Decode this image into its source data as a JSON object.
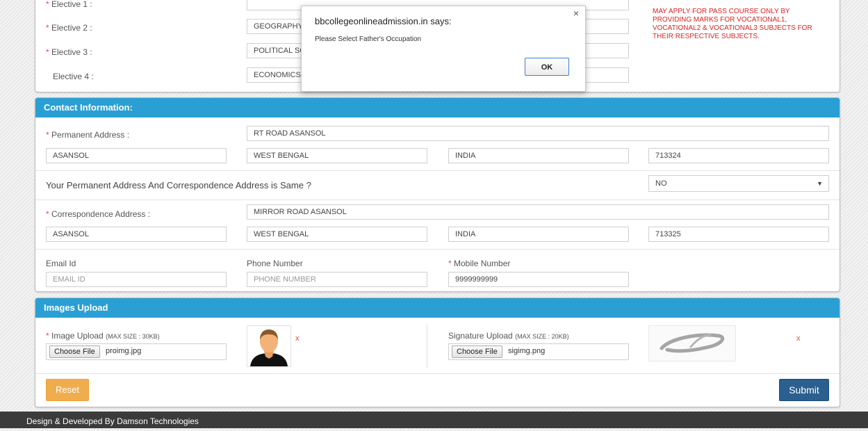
{
  "electives": {
    "rows": [
      {
        "label": "Elective 1 :",
        "value": "",
        "required": true
      },
      {
        "label": "Elective 2 :",
        "value": "GEOGRAPHY",
        "required": true
      },
      {
        "label": "Elective 3 :",
        "value": "POLITICAL SC",
        "required": true
      },
      {
        "label": "Elective 4 :",
        "value": "ECONOMICS",
        "required": false
      }
    ],
    "notice": "MAY APPLY FOR PASS COURSE ONLY BY PROVIDING MARKS FOR VOCATIONAL1, VOCATIONAL2 & VOCATIONAL3 SUBJECTS FOR THEIR RESPECTIVE SUBJECTS."
  },
  "dialog": {
    "title": "bbcollegeonlineadmission.in says:",
    "message": "Please Select Father's Occupation",
    "ok_label": "OK",
    "close_glyph": "×"
  },
  "contact": {
    "header": "Contact Information:",
    "permanent_label": "Permanent Address :",
    "permanent_address": "RT ROAD ASANSOL",
    "permanent_city": "ASANSOL",
    "permanent_state": "WEST BENGAL",
    "permanent_country": "INDIA",
    "permanent_pin": "713324",
    "same_question": "Your Permanent Address And Correspondence Address is Same ?",
    "same_value": "NO",
    "correspondence_label": "Correspondence Address :",
    "correspondence_address": "MIRROR ROAD ASANSOL",
    "correspondence_city": "ASANSOL",
    "correspondence_state": "WEST BENGAL",
    "correspondence_country": "INDIA",
    "correspondence_pin": "713325",
    "email_label": "Email Id",
    "email_placeholder": "EMAIL ID",
    "phone_label": "Phone Number",
    "phone_placeholder": "PHONE NUMBER",
    "mobile_label": "Mobile Number",
    "mobile_value": "9999999999"
  },
  "images": {
    "header": "Images Upload",
    "image_label": "Image Upload",
    "image_size": "(MAX SIZE : 30KB)",
    "image_button": "Choose File",
    "image_file": "proimg.jpg",
    "signature_label": "Signature Upload",
    "signature_size": "(MAX SIZE : 20KB)",
    "signature_button": "Choose File",
    "signature_file": "sigimg.png",
    "remove_glyph": "x"
  },
  "actions": {
    "reset_label": "Reset",
    "submit_label": "Submit"
  },
  "footer": {
    "text": "Design & Developed By Damson Technologies"
  },
  "colors": {
    "header_blue": "#2a9fd4",
    "reset_orange": "#f0ad4e",
    "submit_navy": "#2a5f8f",
    "required_red": "#e74c3c"
  },
  "required_mark": "*"
}
